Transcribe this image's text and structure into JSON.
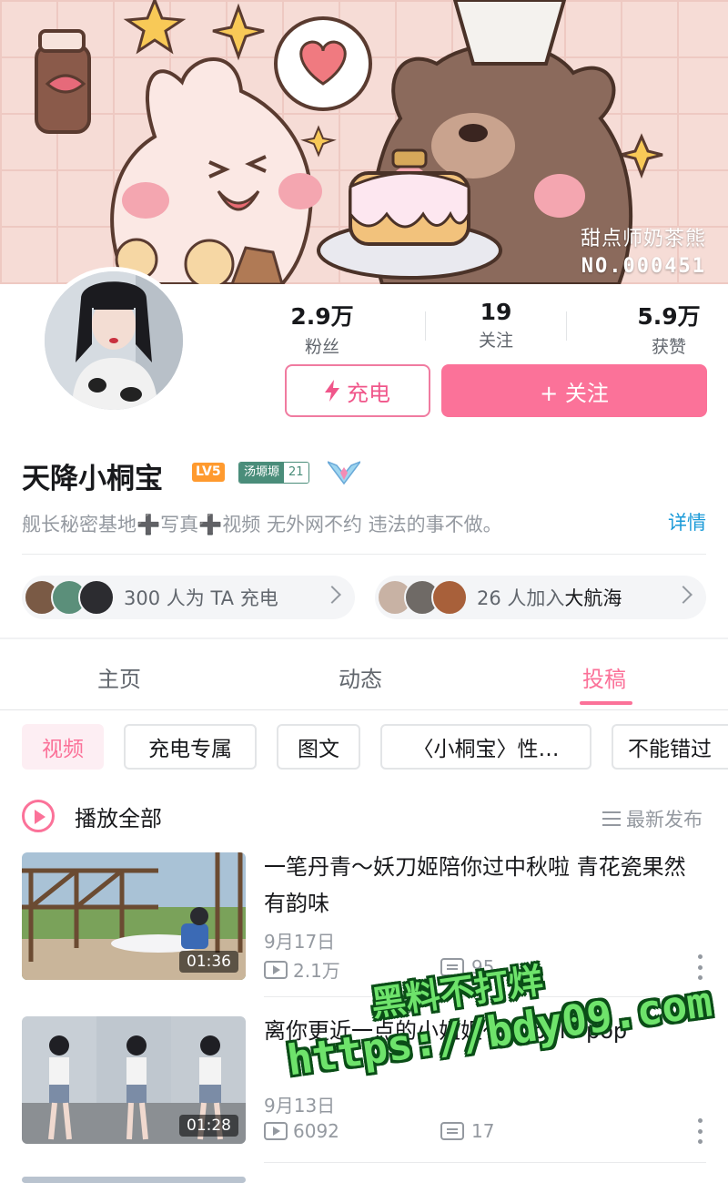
{
  "banner": {
    "tag_line1": "甜点师奶茶熊",
    "tag_line2": "NO.000451"
  },
  "profile": {
    "name": "天降小桐宝",
    "level": "LV5",
    "medal_name": "汤塬塬",
    "medal_level": "21",
    "bio": "舰长秘密基地➕写真➕视频 无外网不约 违法的事不做。",
    "detail_label": "详情"
  },
  "stats": [
    {
      "value": "2.9万",
      "label": "粉丝"
    },
    {
      "value": "19",
      "label": "关注"
    },
    {
      "value": "5.9万",
      "label": "获赞"
    }
  ],
  "actions": {
    "charge_label": "充电",
    "follow_label": "+ 关注"
  },
  "pills": {
    "charge_count": "300",
    "charge_text": "人为 TA 充电",
    "crew_count": "26",
    "crew_text": "人加入",
    "crew_name": "大航海"
  },
  "tabs": [
    "主页",
    "动态",
    "投稿"
  ],
  "active_tab": "投稿",
  "chips": [
    "视频",
    "充电专属",
    "图文",
    "〈小桐宝〉性…",
    "不能错过"
  ],
  "playall_label": "播放全部",
  "sort_label": "最新发布",
  "videos": [
    {
      "title": "一笔丹青～妖刀姬陪你过中秋啦 青花瓷果然有韵味",
      "duration": "01:36",
      "date": "9月17日",
      "views": "2.1万",
      "comments": "95"
    },
    {
      "title": "离你更近一点的小姐姐～bubble pop",
      "duration": "01:28",
      "date": "9月13日",
      "views": "6092",
      "comments": "17"
    }
  ],
  "watermark": {
    "line1": "黑料不打烊",
    "line2": "https://bdy09.com"
  },
  "colors": {
    "accent": "#fb7299",
    "link": "#1a9ad8",
    "level_badge": "#ff9a2e",
    "medal": "#4a8d7a"
  }
}
